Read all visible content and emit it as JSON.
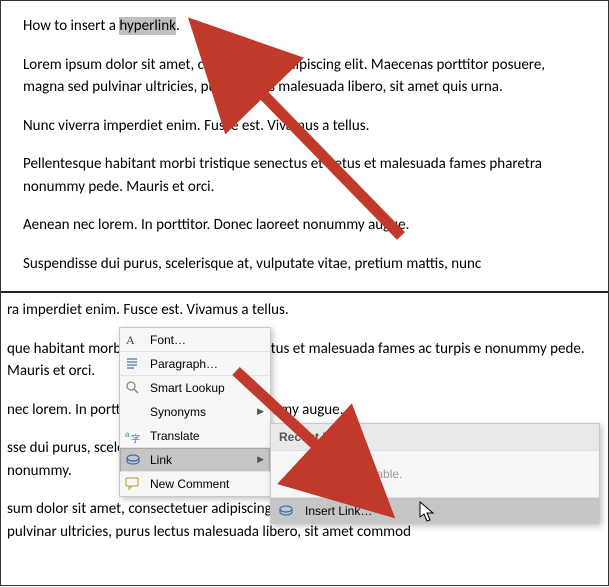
{
  "doc": {
    "title_line_pre": "How to insert a ",
    "title_line_sel": "hyperlink",
    "title_line_post": ".",
    "p1": "Lorem ipsum dolor sit amet, consectetuer adipiscing elit. Maecenas porttitor posuere, magna sed pulvinar ultricies, purus lectus malesuada libero, sit amet quis urna.",
    "p2": "Nunc viverra imperdiet enim. Fusce est. Vivamus a tellus.",
    "p3": "Pellentesque habitant morbi tristique senectus et netus et malesuada fames pharetra nonummy pede. Mauris et orci.",
    "p4": "Aenean nec lorem. In porttitor. Donec laoreet nonummy augue.",
    "p5": "Suspendisse dui purus, scelerisque at, vulputate vitae, pretium mattis, nunc"
  },
  "doc2": {
    "l1": "ra imperdiet enim. Fusce est. Vivamus a tellus.",
    "l2": "que habitant morbi tristique senectus et netus et malesuada fames ac turpis e nonummy pede. Mauris et orci.",
    "l3": "nec lorem. In porttitor. Donec laoreet nonummy augue.",
    "l4": "sse dui purus, scelerisque at, vulputate vitae, pretium mattis, nunc. Mauris s eleifend. Ut nonummy.",
    "l5": "sum dolor sit amet, consectetuer adipiscing elit. Maecenas porttitor congue , magna sed pulvinar ultricies, purus lectus malesuada libero, sit amet commod"
  },
  "menu": {
    "font": "Font…",
    "paragraph": "Paragraph…",
    "smart_lookup": "Smart Lookup",
    "synonyms": "Synonyms",
    "translate": "Translate",
    "link": "Link",
    "new_comment": "New Comment"
  },
  "submenu": {
    "header": "Recent Items",
    "empty": "No items available.",
    "insert_link": "Insert Link…"
  },
  "colors": {
    "arrow": "#c0392b"
  }
}
